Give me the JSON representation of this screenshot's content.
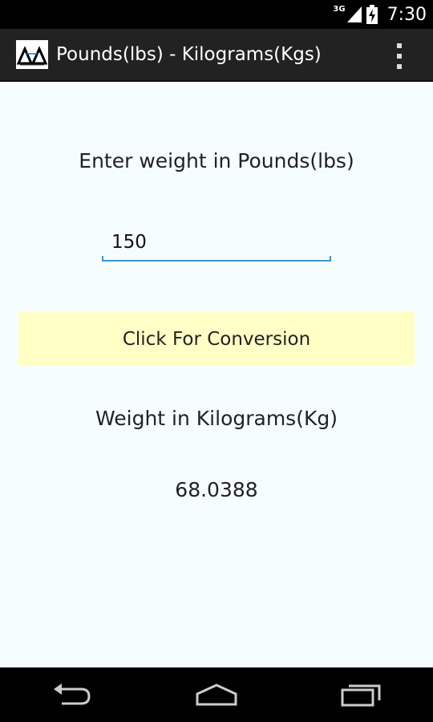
{
  "status_bar": {
    "network_type": "3G",
    "time": "7:30",
    "icons": [
      "signal-icon",
      "battery-charging-icon"
    ]
  },
  "action_bar": {
    "app_icon": "app-logo-icon",
    "title": "Pounds(lbs) - Kilograms(Kgs)",
    "overflow_icon": "overflow-menu-icon"
  },
  "main": {
    "input_label": "Enter weight in Pounds(lbs)",
    "weight_input_value": "150",
    "convert_button_label": "Click For Conversion",
    "result_label": "Weight in Kilograms(Kg)",
    "result_value": "68.0388"
  },
  "nav_bar": {
    "icons": [
      "back-icon",
      "home-icon",
      "recent-apps-icon"
    ]
  },
  "colors": {
    "content_background": "#f5fdfd",
    "action_bar": "#222222",
    "button_background": "#ffffc6",
    "input_accent": "#3a97cf"
  }
}
